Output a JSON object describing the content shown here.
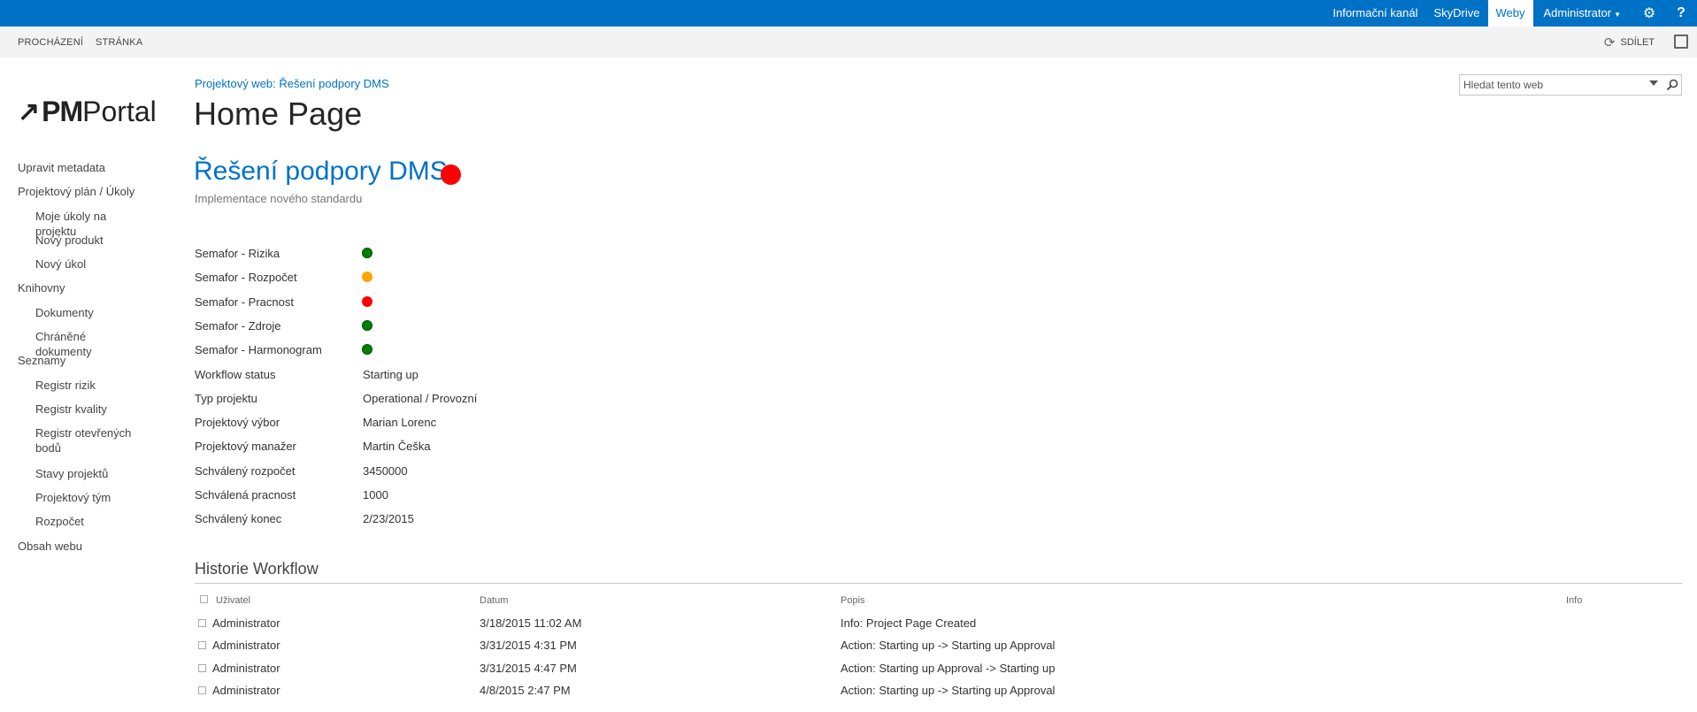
{
  "suite_bar": {
    "links": [
      "Informační kanál",
      "SkyDrive",
      "Weby"
    ],
    "active_link": "Weby",
    "user": "Administrator",
    "accent_color": "#0072c6"
  },
  "ribbon": {
    "tabs": [
      "PROCHÁZENÍ",
      "STRÁNKA"
    ],
    "share_label": "SDÍLET"
  },
  "logo": {
    "mark": "↗",
    "text_bold": "PM",
    "text_regular": "Portal"
  },
  "breadcrumb": "Projektový web: Řešení podpory DMS",
  "page_title": "Home Page",
  "search": {
    "placeholder": "Hledat tento web"
  },
  "left_nav": [
    {
      "label": "Upravit metadata",
      "level": 1
    },
    {
      "label": "Projektový plán / Úkoly",
      "level": 1
    },
    {
      "label": "Moje úkoly na projektu",
      "level": 2
    },
    {
      "label": "Nový produkt",
      "level": 2
    },
    {
      "label": "Nový úkol",
      "level": 2
    },
    {
      "label": "Knihovny",
      "level": 1
    },
    {
      "label": "Dokumenty",
      "level": 2
    },
    {
      "label": "Chráněné dokumenty",
      "level": 2
    },
    {
      "label": "Seznamy",
      "level": 1
    },
    {
      "label": "Registr rizik",
      "level": 2
    },
    {
      "label": "Registr kvality",
      "level": 2
    },
    {
      "label": "Registr otevřených bodů",
      "level": 2
    },
    {
      "label": "Stavy projektů",
      "level": 2
    },
    {
      "label": "Projektový tým",
      "level": 2
    },
    {
      "label": "Rozpočet",
      "level": 2
    },
    {
      "label": "Obsah webu",
      "level": 1
    }
  ],
  "project": {
    "title": "Řešení podpory DMS",
    "subtitle": "Implementace nového standardu",
    "overall_status": "red"
  },
  "semaphores": [
    {
      "label": "Semafor - Rizika",
      "status": "green"
    },
    {
      "label": "Semafor - Rozpočet",
      "status": "orange"
    },
    {
      "label": "Semafor - Pracnost",
      "status": "red"
    },
    {
      "label": "Semafor - Zdroje",
      "status": "green"
    },
    {
      "label": "Semafor - Harmonogram",
      "status": "green"
    }
  ],
  "properties": [
    {
      "label": "Workflow status",
      "value": "Starting up"
    },
    {
      "label": "Typ projektu",
      "value": "Operational / Provozní"
    },
    {
      "label": "Projektový výbor",
      "value": "Marian Lorenc"
    },
    {
      "label": "Projektový manažer",
      "value": "Martin Češka"
    },
    {
      "label": "Schválený rozpočet",
      "value": "3450000"
    },
    {
      "label": "Schválená pracnost",
      "value": "1000"
    },
    {
      "label": "Schválený konec",
      "value": "2/23/2015"
    }
  ],
  "workflow_history": {
    "title": "Historie Workflow",
    "columns": [
      "Uživatel",
      "Datum",
      "Popis",
      "Info"
    ],
    "rows": [
      {
        "user": "Administrator",
        "date": "3/18/2015 11:02 AM",
        "description": "Info: Project Page Created",
        "info": ""
      },
      {
        "user": "Administrator",
        "date": "3/31/2015 4:31 PM",
        "description": "Action: Starting up -> Starting up Approval",
        "info": ""
      },
      {
        "user": "Administrator",
        "date": "3/31/2015 4:47 PM",
        "description": "Action: Starting up Approval -> Starting up",
        "info": ""
      },
      {
        "user": "Administrator",
        "date": "4/8/2015 2:47 PM",
        "description": "Action: Starting up -> Starting up Approval",
        "info": ""
      }
    ]
  }
}
